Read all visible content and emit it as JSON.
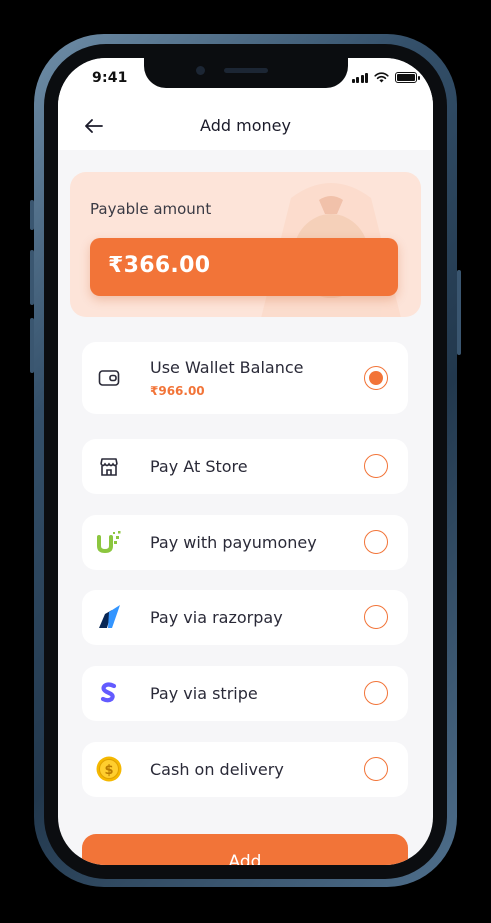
{
  "status_bar": {
    "time": "9:41"
  },
  "header": {
    "title": "Add money",
    "back_icon": "arrow-left-icon"
  },
  "payable": {
    "label": "Payable amount",
    "amount": "₹366.00",
    "decoration_icon": "money-bag-icon"
  },
  "options": [
    {
      "label": "Use Wallet Balance",
      "sublabel": "₹966.00",
      "icon": "wallet-icon",
      "selected": true
    },
    {
      "label": "Pay At Store",
      "icon": "store-icon",
      "selected": false
    },
    {
      "label": "Pay with payumoney",
      "icon": "payumoney-logo-icon",
      "selected": false
    },
    {
      "label": "Pay via razorpay",
      "icon": "razorpay-logo-icon",
      "selected": false
    },
    {
      "label": "Pay via stripe",
      "icon": "stripe-logo-icon",
      "selected": false
    },
    {
      "label": "Cash on delivery",
      "icon": "coin-icon",
      "selected": false
    }
  ],
  "add_button": {
    "label": "Add"
  },
  "colors": {
    "accent": "#F27438",
    "card_bg": "#FDE4D9",
    "screen_bg": "#F6F6F8"
  }
}
